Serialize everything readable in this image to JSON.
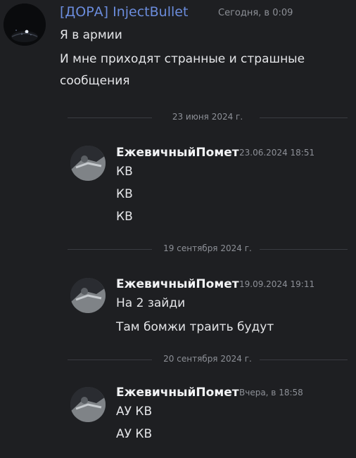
{
  "first_message": {
    "author": "[ДОРА] InjectBullet",
    "timestamp": "Сегодня, в 0:09",
    "lines": [
      "Я в армии",
      "И мне приходят странные и страшные",
      "сообщения"
    ],
    "author_color": "#6b8cdc"
  },
  "dividers": [
    "23 июня 2024 г.",
    "19 сентября 2024 г.",
    "20 сентября 2024 г."
  ],
  "messages": [
    {
      "author": "ЕжевичныйПомет",
      "timestamp": "23.06.2024 18:51",
      "lines": [
        "КВ",
        "КВ",
        "КВ"
      ]
    },
    {
      "author": "ЕжевичныйПомет",
      "timestamp": "19.09.2024 19:11",
      "lines": [
        "На 2 зайди",
        "Там бомжи траить будут"
      ]
    },
    {
      "author": "ЕжевичныйПомет",
      "timestamp": "Вчера, в 18:58",
      "lines": [
        "АУ КВ",
        "АУ КВ"
      ]
    }
  ],
  "icons": {
    "main_avatar": "avatar-night-scene-icon",
    "reply_avatar": "avatar-photo-icon"
  },
  "colors": {
    "background": "#1e1f22",
    "text": "#dcdde1",
    "muted": "#8d9097",
    "divider": "#3a3c42"
  }
}
